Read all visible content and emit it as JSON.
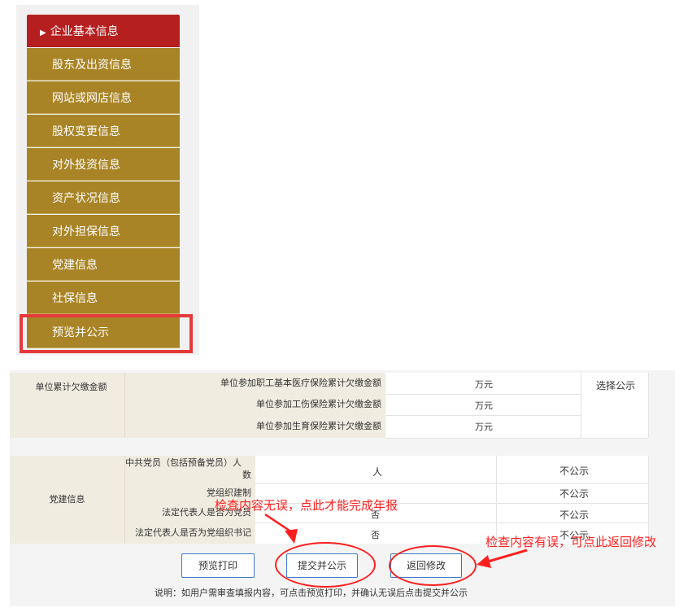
{
  "menu": {
    "items": [
      {
        "label": "企业基本信息",
        "active": true
      },
      {
        "label": "股东及出资信息"
      },
      {
        "label": "网站或网店信息"
      },
      {
        "label": "股权变更信息"
      },
      {
        "label": "对外投资信息"
      },
      {
        "label": "资产状况信息"
      },
      {
        "label": "对外担保信息"
      },
      {
        "label": "党建信息"
      },
      {
        "label": "社保信息"
      },
      {
        "label": "预览并公示"
      }
    ],
    "active_marker": "▶"
  },
  "arrears": {
    "label": "单位累计欠缴金额",
    "rows": [
      {
        "label": "单位参加职工基本医疗保险累计欠缴金额",
        "unit": "万元"
      },
      {
        "label": "单位参加工伤保险累计欠缴金额",
        "unit": "万元"
      },
      {
        "label": "单位参加生育保险累计欠缴金额",
        "unit": "万元"
      }
    ],
    "publish": "选择公示"
  },
  "party": {
    "label": "党建信息",
    "rows": [
      {
        "label_line1": "中共党员（包括预备党员）人",
        "label_line2": "数",
        "value": "人",
        "publish": "不公示"
      },
      {
        "label": "党组织建制",
        "value": "",
        "publish": "不公示"
      },
      {
        "label": "法定代表人是否为党员",
        "value": "否",
        "publish": "不公示"
      },
      {
        "label": "法定代表人是否为党组织书记",
        "value": "否",
        "publish": "不公示"
      }
    ]
  },
  "buttons": {
    "preview_print": "预览打印",
    "submit_publish": "提交并公示",
    "go_back": "返回修改"
  },
  "note": "说明：如用户需审查填报内容，可点击预览打印，并确认无误后点击提交并公示",
  "annotations": {
    "correct": "检查内容无误，点此才能完成年报",
    "incorrect": "检查内容有误，可点此返回修改"
  },
  "colors": {
    "menu_gold": "#a98426",
    "menu_active_red": "#b51f1f",
    "annotation_red": "#ff2020",
    "button_border": "#3c78c8"
  }
}
